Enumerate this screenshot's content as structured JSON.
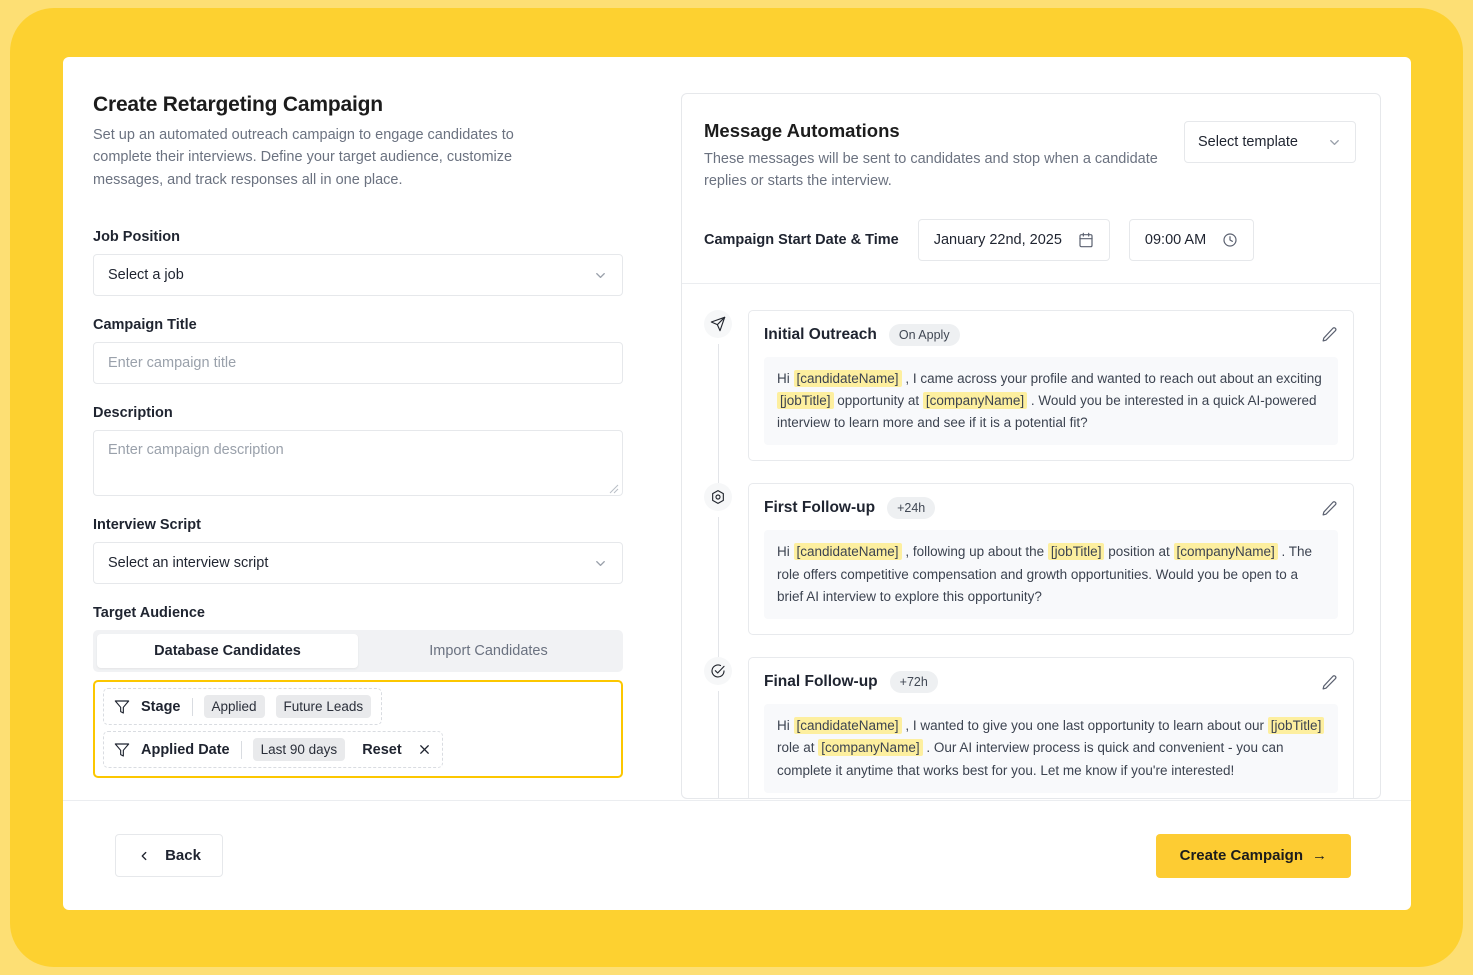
{
  "left": {
    "title": "Create Retargeting Campaign",
    "subtitle": "Set up an automated outreach campaign to engage candidates to complete their interviews. Define your target audience, customize messages, and track responses all in one place.",
    "job_position": {
      "label": "Job Position",
      "value": "Select a job"
    },
    "campaign_title": {
      "label": "Campaign Title",
      "placeholder": "Enter campaign title",
      "value": ""
    },
    "description": {
      "label": "Description",
      "placeholder": "Enter campaign description",
      "value": ""
    },
    "interview_script": {
      "label": "Interview Script",
      "value": "Select an interview script"
    },
    "target_audience": {
      "label": "Target Audience",
      "tabs": [
        {
          "label": "Database Candidates",
          "active": true
        },
        {
          "label": "Import Candidates",
          "active": false
        }
      ],
      "filters": [
        {
          "icon": "funnel-icon",
          "name": "Stage",
          "chips": [
            "Applied",
            "Future Leads"
          ]
        },
        {
          "icon": "funnel-icon",
          "name": "Applied Date",
          "chips": [
            "Last 90 days"
          ],
          "reset_label": "Reset"
        }
      ]
    }
  },
  "right": {
    "title": "Message Automations",
    "subtitle": "These messages will be sent to candidates and stop when a candidate replies or starts the interview.",
    "template_select": {
      "value": "Select template"
    },
    "schedule": {
      "label": "Campaign Start Date & Time",
      "date": "January 22nd, 2025",
      "time": "09:00 AM"
    },
    "messages": [
      {
        "icon": "send-icon",
        "title": "Initial Outreach",
        "badge": "On Apply",
        "body_parts": [
          {
            "t": "Hi "
          },
          {
            "t": "[candidateName]",
            "var": true
          },
          {
            "t": " , I came across your profile and wanted to reach out about an exciting "
          },
          {
            "t": "[jobTitle]",
            "var": true
          },
          {
            "t": " opportunity at "
          },
          {
            "t": "[companyName]",
            "var": true
          },
          {
            "t": " . Would you be interested in a quick AI-powered interview to learn more and see if it is a potential fit?"
          }
        ]
      },
      {
        "icon": "settings-hex-icon",
        "title": "First Follow-up",
        "badge": "+24h",
        "body_parts": [
          {
            "t": "Hi "
          },
          {
            "t": "[candidateName]",
            "var": true
          },
          {
            "t": " , following up about the "
          },
          {
            "t": "[jobTitle]",
            "var": true
          },
          {
            "t": " position at "
          },
          {
            "t": "[companyName]",
            "var": true
          },
          {
            "t": " . The role offers competitive compensation and growth opportunities. Would you be open to a brief AI interview to explore this opportunity?"
          }
        ]
      },
      {
        "icon": "check-circle-icon",
        "title": "Final Follow-up",
        "badge": "+72h",
        "body_parts": [
          {
            "t": "Hi "
          },
          {
            "t": "[candidateName]",
            "var": true
          },
          {
            "t": " , I wanted to give you one last opportunity to learn about our "
          },
          {
            "t": "[jobTitle]",
            "var": true
          },
          {
            "t": " role at "
          },
          {
            "t": "[companyName]",
            "var": true
          },
          {
            "t": " . Our AI interview process is quick and convenient - you can complete it anytime that works best for you. Let me know if you're interested!"
          }
        ]
      }
    ]
  },
  "footer": {
    "back_label": "Back",
    "create_label": "Create Campaign",
    "create_arrow": "→"
  },
  "colors": {
    "accent": "#fdcc33",
    "page_bg": "#fddf74",
    "page_bg_inner": "#fdd130",
    "highlight": "#fdef9f",
    "filter_outline": "#fcc700"
  }
}
